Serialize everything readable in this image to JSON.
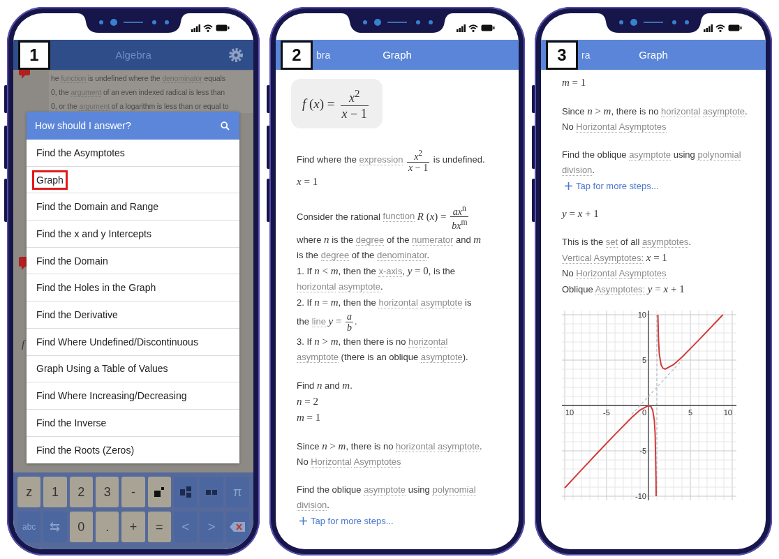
{
  "phones": [
    {
      "kind": "menu",
      "badge": "1",
      "header": {
        "title": "Algebra"
      },
      "background": {
        "lines": [
          [
            {
              "kind": "text",
              "text": "he "
            },
            {
              "kind": "term",
              "text": "function"
            },
            {
              "kind": "text",
              "text": " is undefined where the "
            },
            {
              "kind": "term",
              "text": "denominator"
            },
            {
              "kind": "text",
              "text": " equals"
            }
          ],
          [
            {
              "kind": "text",
              "text": "0, the "
            },
            {
              "kind": "term",
              "text": "argument"
            },
            {
              "kind": "text",
              "text": " of an even indexed radical is less than"
            }
          ],
          [
            {
              "kind": "text",
              "text": "0, or the "
            },
            {
              "kind": "term",
              "text": "argument"
            },
            {
              "kind": "text",
              "text": " of a logarithm is less than or equal to"
            }
          ]
        ],
        "input_label": "f"
      },
      "dialog": {
        "title": "How should I answer?",
        "options": [
          {
            "label": "Find the Asymptotes",
            "selected": false
          },
          {
            "label": "Graph",
            "selected": true
          },
          {
            "label": "Find the Domain and Range",
            "selected": false
          },
          {
            "label": "Find the x and y Intercepts",
            "selected": false
          },
          {
            "label": "Find the Domain",
            "selected": false
          },
          {
            "label": "Find the Holes in the Graph",
            "selected": false
          },
          {
            "label": "Find the Derivative",
            "selected": false
          },
          {
            "label": "Find Where Undefined/Discontinuous",
            "selected": false
          },
          {
            "label": "Graph Using a Table of Values",
            "selected": false
          },
          {
            "label": "Find Where Increasing/Decreasing",
            "selected": false
          },
          {
            "label": "Find the Inverse",
            "selected": false
          },
          {
            "label": "Find the Roots (Zeros)",
            "selected": false
          }
        ]
      },
      "keyboard": {
        "rows": [
          {
            "keys": [
              {
                "kind": "digit",
                "label": "z"
              },
              {
                "kind": "digit",
                "label": "1"
              },
              {
                "kind": "digit",
                "label": "2"
              },
              {
                "kind": "digit",
                "label": "3"
              },
              {
                "kind": "digit",
                "label": "-"
              },
              {
                "kind": "power"
              },
              {
                "kind": "fraction"
              },
              {
                "kind": "pair"
              },
              {
                "kind": "symbol",
                "label": "π"
              }
            ]
          },
          {
            "keys": [
              {
                "kind": "symbol",
                "label": "abc"
              },
              {
                "kind": "symbol",
                "label": "⇆"
              },
              {
                "kind": "digit",
                "label": "0"
              },
              {
                "kind": "digit",
                "label": "."
              },
              {
                "kind": "digit",
                "label": "+"
              },
              {
                "kind": "digit",
                "label": "="
              },
              {
                "kind": "symbol",
                "label": "<"
              },
              {
                "kind": "symbol",
                "label": ">"
              },
              {
                "kind": "backspace"
              }
            ]
          }
        ]
      }
    },
    {
      "kind": "steps",
      "badge": "2",
      "header": {
        "back": "bra",
        "title": "Graph"
      },
      "formula": {
        "lhs": "*f* (*x*) =",
        "num": "*x*$^{2}$",
        "den": "*x* − 1"
      },
      "blocks": [
        {
          "lines": [
            {
              "kind": "text",
              "parts": [
                {
                  "kind": "text",
                  "text": "Find where the "
                },
                {
                  "kind": "term",
                  "text": "expression"
                },
                {
                  "kind": "frac",
                  "num": "*x*$^{2}$",
                  "den": "*x* − 1"
                },
                {
                  "kind": "text",
                  "text": " is undefined."
                }
              ]
            },
            {
              "kind": "text",
              "parts": [
                {
                  "kind": "math",
                  "text": "*x* = 1"
                }
              ]
            }
          ]
        },
        {
          "lines": [
            {
              "kind": "text",
              "parts": [
                {
                  "kind": "text",
                  "text": "Consider the rational "
                },
                {
                  "kind": "term",
                  "text": "function"
                },
                {
                  "kind": "math",
                  "text": "*R* (*x*) ="
                },
                {
                  "kind": "frac",
                  "num": "*ax*$^{n}$",
                  "den": "*bx*$^{m}$"
                }
              ]
            },
            {
              "kind": "text",
              "parts": [
                {
                  "kind": "text",
                  "text": "where "
                },
                {
                  "kind": "math",
                  "text": "*n*"
                },
                {
                  "kind": "text",
                  "text": " is the "
                },
                {
                  "kind": "term",
                  "text": "degree"
                },
                {
                  "kind": "text",
                  "text": " of the "
                },
                {
                  "kind": "term",
                  "text": "numerator"
                },
                {
                  "kind": "text",
                  "text": " and "
                },
                {
                  "kind": "math",
                  "text": "*m*"
                }
              ]
            },
            {
              "kind": "text",
              "parts": [
                {
                  "kind": "text",
                  "text": "is the "
                },
                {
                  "kind": "term",
                  "text": "degree"
                },
                {
                  "kind": "text",
                  "text": " of the "
                },
                {
                  "kind": "term",
                  "text": "denominator"
                },
                {
                  "kind": "text",
                  "text": "."
                }
              ]
            },
            {
              "kind": "text",
              "parts": [
                {
                  "kind": "text",
                  "text": "1. If "
                },
                {
                  "kind": "math",
                  "text": "*n* < *m*"
                },
                {
                  "kind": "text",
                  "text": ", then the "
                },
                {
                  "kind": "term",
                  "text": "x-axis"
                },
                {
                  "kind": "text",
                  "text": ", "
                },
                {
                  "kind": "math",
                  "text": "*y* = 0"
                },
                {
                  "kind": "text",
                  "text": ", is the"
                }
              ]
            },
            {
              "kind": "text",
              "parts": [
                {
                  "kind": "term",
                  "text": "horizontal"
                },
                {
                  "kind": "term",
                  "text": "asymptote"
                },
                {
                  "kind": "text",
                  "text": "."
                }
              ]
            },
            {
              "kind": "text",
              "parts": [
                {
                  "kind": "text",
                  "text": "2. If "
                },
                {
                  "kind": "math",
                  "text": "*n* = *m*"
                },
                {
                  "kind": "text",
                  "text": ", then the "
                },
                {
                  "kind": "term",
                  "text": "horizontal"
                },
                {
                  "kind": "term",
                  "text": "asymptote"
                },
                {
                  "kind": "text",
                  "text": " is"
                }
              ]
            },
            {
              "kind": "text",
              "parts": [
                {
                  "kind": "text",
                  "text": "the "
                },
                {
                  "kind": "term",
                  "text": "line"
                },
                {
                  "kind": "math",
                  "text": "*y* ="
                },
                {
                  "kind": "frac",
                  "num": "*a*",
                  "den": "*b*"
                },
                {
                  "kind": "text",
                  "text": "."
                }
              ]
            },
            {
              "kind": "text",
              "parts": [
                {
                  "kind": "text",
                  "text": "3. If "
                },
                {
                  "kind": "math",
                  "text": "*n* > *m*"
                },
                {
                  "kind": "text",
                  "text": ", then there is no "
                },
                {
                  "kind": "term",
                  "text": "horizontal"
                }
              ]
            },
            {
              "kind": "text",
              "parts": [
                {
                  "kind": "term",
                  "text": "asymptote"
                },
                {
                  "kind": "text",
                  "text": " (there is an oblique "
                },
                {
                  "kind": "term",
                  "text": "asymptote"
                },
                {
                  "kind": "text",
                  "text": ")."
                }
              ]
            }
          ]
        },
        {
          "lines": [
            {
              "kind": "text",
              "parts": [
                {
                  "kind": "text",
                  "text": "Find "
                },
                {
                  "kind": "math",
                  "text": "*n*"
                },
                {
                  "kind": "text",
                  "text": " and "
                },
                {
                  "kind": "math",
                  "text": "*m*"
                },
                {
                  "kind": "text",
                  "text": "."
                }
              ]
            },
            {
              "kind": "text",
              "parts": [
                {
                  "kind": "math",
                  "text": "*n* = 2"
                }
              ]
            },
            {
              "kind": "text",
              "parts": [
                {
                  "kind": "math",
                  "text": "*m* = 1"
                }
              ]
            }
          ]
        },
        {
          "lines": [
            {
              "kind": "text",
              "parts": [
                {
                  "kind": "text",
                  "text": "Since "
                },
                {
                  "kind": "math",
                  "text": "*n* > *m*"
                },
                {
                  "kind": "text",
                  "text": ", there is no "
                },
                {
                  "kind": "term",
                  "text": "horizontal"
                },
                {
                  "kind": "term",
                  "text": "asymptote"
                },
                {
                  "kind": "text",
                  "text": "."
                }
              ]
            },
            {
              "kind": "text",
              "parts": [
                {
                  "kind": "text",
                  "text": "No "
                },
                {
                  "kind": "term",
                  "text": "Horizontal"
                },
                {
                  "kind": "term",
                  "text": "Asymptotes"
                }
              ]
            }
          ]
        },
        {
          "lines": [
            {
              "kind": "text",
              "parts": [
                {
                  "kind": "text",
                  "text": "Find the oblique "
                },
                {
                  "kind": "term",
                  "text": "asymptote"
                },
                {
                  "kind": "text",
                  "text": " using "
                },
                {
                  "kind": "term",
                  "text": "polynomial"
                }
              ]
            },
            {
              "kind": "text",
              "parts": [
                {
                  "kind": "term",
                  "text": "division"
                },
                {
                  "kind": "text",
                  "text": "."
                }
              ]
            },
            {
              "kind": "more",
              "text": "Tap for more steps..."
            }
          ]
        }
      ]
    },
    {
      "kind": "steps",
      "badge": "3",
      "header": {
        "back": "ra",
        "title": "Graph"
      },
      "blocks": [
        {
          "lines": [
            {
              "kind": "text",
              "parts": [
                {
                  "kind": "math",
                  "text": "*m* = 1"
                }
              ]
            }
          ]
        },
        {
          "lines": [
            {
              "kind": "text",
              "parts": [
                {
                  "kind": "text",
                  "text": "Since "
                },
                {
                  "kind": "math",
                  "text": "*n* > *m*"
                },
                {
                  "kind": "text",
                  "text": ", there is no "
                },
                {
                  "kind": "term",
                  "text": "horizontal"
                },
                {
                  "kind": "term",
                  "text": "asymptote"
                },
                {
                  "kind": "text",
                  "text": "."
                }
              ]
            },
            {
              "kind": "text",
              "parts": [
                {
                  "kind": "text",
                  "text": "No "
                },
                {
                  "kind": "term",
                  "text": "Horizontal"
                },
                {
                  "kind": "term",
                  "text": "Asymptotes"
                }
              ]
            }
          ]
        },
        {
          "lines": [
            {
              "kind": "text",
              "parts": [
                {
                  "kind": "text",
                  "text": "Find the oblique "
                },
                {
                  "kind": "term",
                  "text": "asymptote"
                },
                {
                  "kind": "text",
                  "text": " using "
                },
                {
                  "kind": "term",
                  "text": "polynomial"
                }
              ]
            },
            {
              "kind": "text",
              "parts": [
                {
                  "kind": "term",
                  "text": "division"
                },
                {
                  "kind": "text",
                  "text": "."
                }
              ]
            },
            {
              "kind": "more",
              "text": "Tap for more steps..."
            }
          ]
        },
        {
          "lines": [
            {
              "kind": "text",
              "parts": [
                {
                  "kind": "math",
                  "text": "*y* = *x* + 1"
                }
              ]
            }
          ]
        },
        {
          "lines": [
            {
              "kind": "text",
              "parts": [
                {
                  "kind": "text",
                  "text": "This is the "
                },
                {
                  "kind": "term",
                  "text": "set"
                },
                {
                  "kind": "text",
                  "text": " of all "
                },
                {
                  "kind": "term",
                  "text": "asymptotes"
                },
                {
                  "kind": "text",
                  "text": "."
                }
              ]
            },
            {
              "kind": "text",
              "parts": [
                {
                  "kind": "term",
                  "text": "Vertical"
                },
                {
                  "kind": "term",
                  "text": "Asymptotes:"
                },
                {
                  "kind": "math",
                  "text": "*x* = 1"
                }
              ]
            },
            {
              "kind": "text",
              "parts": [
                {
                  "kind": "text",
                  "text": "No "
                },
                {
                  "kind": "term",
                  "text": "Horizontal"
                },
                {
                  "kind": "term",
                  "text": "Asymptotes"
                }
              ]
            },
            {
              "kind": "text",
              "parts": [
                {
                  "kind": "text",
                  "text": "Oblique "
                },
                {
                  "kind": "term",
                  "text": "Asymptotes:"
                },
                {
                  "kind": "math",
                  "text": "*y* = *x* + 1"
                }
              ]
            }
          ]
        }
      ],
      "chart_data": {
        "type": "line",
        "grid": true,
        "xlim": [
          -10,
          10
        ],
        "ylim": [
          -10,
          10
        ],
        "xticks": [
          {
            "value": -10,
            "label": "10"
          },
          {
            "value": -5,
            "label": "-5"
          },
          {
            "value": 0,
            "label": "0"
          },
          {
            "value": 5,
            "label": "5"
          },
          {
            "value": 10,
            "label": "10"
          }
        ],
        "yticks": [
          {
            "value": -10,
            "label": "-10"
          },
          {
            "value": -5,
            "label": "-5"
          },
          {
            "value": 5,
            "label": "5"
          },
          {
            "value": 10,
            "label": "10"
          }
        ],
        "x": [
          -10,
          -8,
          -6,
          -4,
          -2,
          -1,
          0,
          0.3,
          0.5,
          0.7,
          0.8,
          0.9,
          0.916,
          1.127,
          1.2,
          1.3,
          1.5,
          1.7,
          2,
          3,
          4,
          6,
          8,
          8.873
        ],
        "series": [
          {
            "color": "#d23a3a",
            "line_style": "solid",
            "values": [
              -9.09,
              -7.11,
              -5.14,
              -3.2,
              -1.33,
              -0.5,
              0,
              -0.13,
              -0.5,
              -1.63,
              -3.2,
              -8.1,
              -10,
              10,
              7.2,
              5.63,
              4.5,
              4.13,
              4,
              4.5,
              5.33,
              7.2,
              9.14,
              10
            ]
          },
          {
            "color": "#b8c0c8",
            "line_style": "dashed",
            "values": [
              null,
              null,
              null,
              null,
              -1,
              0,
              1,
              1.3,
              1.5,
              1.7,
              1.8,
              1.9,
              1.9,
              2.1,
              2.2,
              2.3,
              2.5,
              2.7,
              3,
              4,
              5,
              null,
              null,
              null
            ]
          }
        ],
        "ref_lines": [
          {
            "axis": "x",
            "value": 1,
            "color": "#b8c0c8"
          }
        ]
      }
    }
  ]
}
